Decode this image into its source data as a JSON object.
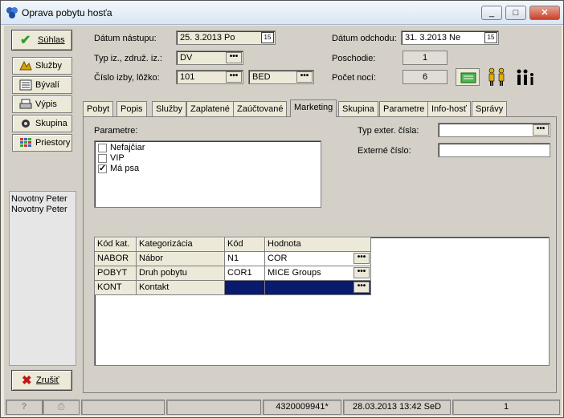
{
  "window": {
    "title": "Oprava pobytu hosťa",
    "buttons": [
      "_",
      "□",
      "X"
    ]
  },
  "left_panel": {
    "ok_label": "Súhlas",
    "buttons": [
      "Služby",
      "Bývalí",
      "Výpis",
      "Skupina",
      "Priestory"
    ],
    "guests": [
      "Novotny Peter",
      "Novotny Peter"
    ],
    "cancel_label": "Zrušiť"
  },
  "header": {
    "arrival_label": "Dátum nástupu:",
    "arrival_value": "25. 3.2013  Po",
    "departure_label": "Dátum odchodu:",
    "departure_value": "31. 3.2013  Ne",
    "room_type_label": "Typ iz., združ. iz.:",
    "room_type_value": "DV",
    "floor_label": "Poschodie:",
    "floor_value": "1",
    "room_label": "Číslo izby, lôžko:",
    "room_value": "101",
    "bed_value": "BED",
    "nights_label": "Počet nocí:",
    "nights_value": "6"
  },
  "tabs": [
    "Pobyt",
    "Popis",
    "Služby",
    "Zaplatené",
    "Zaúčtované",
    "Marketing",
    "Skupina",
    "Parametre",
    "Info-hosť",
    "Správy"
  ],
  "active_tab": "Marketing",
  "marketing": {
    "params_label": "Parametre:",
    "params": [
      {
        "label": "Nefajčiar",
        "checked": false
      },
      {
        "label": "VIP",
        "checked": false
      },
      {
        "label": "Má psa",
        "checked": true
      }
    ],
    "ext_type_label": "Typ exter. čísla:",
    "ext_type_value": "",
    "ext_number_label": "Externé číslo:",
    "ext_number_value": ""
  },
  "grid": {
    "columns": [
      "Kód kat.",
      "Kategorizácia",
      "Kód",
      "Hodnota"
    ],
    "rows": [
      {
        "code": "NABOR",
        "category": "Nábor",
        "kod": "N1",
        "value": "COR"
      },
      {
        "code": "POBYT",
        "category": "Druh pobytu",
        "kod": "COR1",
        "value": "MICE Groups"
      },
      {
        "code": "KONT",
        "category": "Kontakt",
        "kod": "",
        "value": ""
      }
    ]
  },
  "statusbar": {
    "help": "?",
    "printer": "⎙",
    "account": "4320009941*",
    "datetime": "28.03.2013 13:42 SeD",
    "page": "1"
  },
  "colors": {
    "selection": "#0a1a6e",
    "ok_check": "#2a9d2a",
    "cancel_x": "#c01818"
  }
}
